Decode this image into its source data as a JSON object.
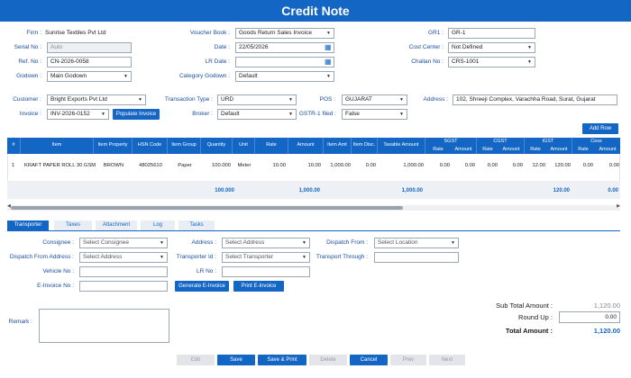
{
  "title": "Credit Note",
  "header": {
    "firm": {
      "label": "Firm :",
      "value": "Sunrise Textiles Pvt Ltd"
    },
    "voucher_book": {
      "label": "Voucher Book :",
      "value": "Goods Return Sales Invoice"
    },
    "gr1": {
      "label": "GR1 :",
      "value": "GR-1"
    },
    "serial_no": {
      "label": "Serial No :",
      "placeholder": "Auto"
    },
    "date": {
      "label": "Date :",
      "value": "22/05/2026"
    },
    "cost_center": {
      "label": "Cost Center :",
      "value": "Not Defined"
    },
    "ref_no": {
      "label": "Ref. No :",
      "value": "CN-2026-0058"
    },
    "lr_date": {
      "label": "LR Date :",
      "value": ""
    },
    "challan_no": {
      "label": "Challan No :",
      "value": "CRS-1001"
    },
    "godown": {
      "label": "Godown :",
      "value": "Main Godown"
    },
    "category_godown": {
      "label": "Category Godown :",
      "value": "Default"
    }
  },
  "party": {
    "customer": {
      "label": "Customer :",
      "value": "Bright Exports Pvt Ltd"
    },
    "transaction_type": {
      "label": "Transaction Type :",
      "value": "URD"
    },
    "pos": {
      "label": "POS :",
      "value": "GUJARAT"
    },
    "address": {
      "label": "Address :",
      "value": "102, Shreeji Complex, Varachha Road, Surat, Gujarat"
    },
    "invoice": {
      "label": "Invoice :",
      "value": "INV-2026-0152"
    },
    "populate_invoice": "Populate Invoice",
    "broker": {
      "label": "Broker :",
      "value": "Default"
    },
    "gstr1_filed": {
      "label": "GSTR-1 filed :",
      "value": "False"
    }
  },
  "add_row": "Add Row",
  "grid": {
    "headers": [
      "#",
      "Item",
      "Item Property",
      "HSN Code",
      "Item Group",
      "Quantity",
      "Unit",
      "Rate",
      "Amount",
      "Item Amt",
      "Item Disc.",
      "Taxable Amount",
      "SGST",
      "CGST",
      "IGST",
      "Cess"
    ],
    "sub_headers": [
      "Rate",
      "Amount",
      "Rate",
      "Amount",
      "Rate",
      "Amount",
      "Rate",
      "Amount"
    ],
    "row": {
      "no": "1",
      "item": "KRAFT PAPER ROLL 30 GSM",
      "property": "BROWN",
      "hsn": "48025610",
      "group": "Paper",
      "qty": "100.000",
      "unit": "Meter",
      "rate": "10.00",
      "amount": "10.00",
      "item_amt": "1,000.00",
      "disc": "0.00",
      "taxable": "1,000.00",
      "sgst_rate": "0.00",
      "sgst_amt": "0.00",
      "cgst_rate": "0.00",
      "cgst_amt": "0.00",
      "igst_rate": "12.00",
      "igst_amt": "120.00",
      "cess_rate": "0.00",
      "cess_amt": "0.00"
    },
    "totals": {
      "qty": "100.000",
      "item_amt": "1,000.00",
      "taxable": "1,000.00",
      "igst_amt": "120.00",
      "cess_amt": "0.00"
    }
  },
  "tabs": [
    "Transporter",
    "Taxes",
    "Attachment",
    "Log",
    "Tasks"
  ],
  "transport": {
    "consignee": {
      "label": "Consignee :",
      "placeholder": "Select Consignee"
    },
    "address": {
      "label": "Address :",
      "placeholder": "Select Address"
    },
    "dispatch_from": {
      "label": "Dispatch From :",
      "placeholder": "Select Location"
    },
    "dispatch_from_address": {
      "label": "Dispatch From Address :",
      "placeholder": "Select Address"
    },
    "transporter_id": {
      "label": "Transporter Id :",
      "placeholder": "Select Transporter"
    },
    "transport_through": {
      "label": "Transport Through :",
      "value": ""
    },
    "vehicle_no": {
      "label": "Vehicle No :",
      "value": ""
    },
    "lr_no": {
      "label": "LR No :",
      "value": ""
    },
    "einvoice_no": {
      "label": "E-Invoice No :",
      "value": ""
    },
    "generate_einvoice": "Generate E-Invoice",
    "print_einvoice": "Print E-Invoice"
  },
  "remark": {
    "label": "Remark :",
    "value": ""
  },
  "summary": {
    "sub_total_label": "Sub Total Amount :",
    "sub_total": "1,120.00",
    "round_up_label": "Round Up :",
    "round_up": "0.00",
    "total_label": "Total Amount :",
    "total": "1,120.00"
  },
  "footer": [
    "Edit",
    "Save",
    "Save & Print",
    "Delete",
    "Cancel",
    "Prev",
    "Next"
  ]
}
